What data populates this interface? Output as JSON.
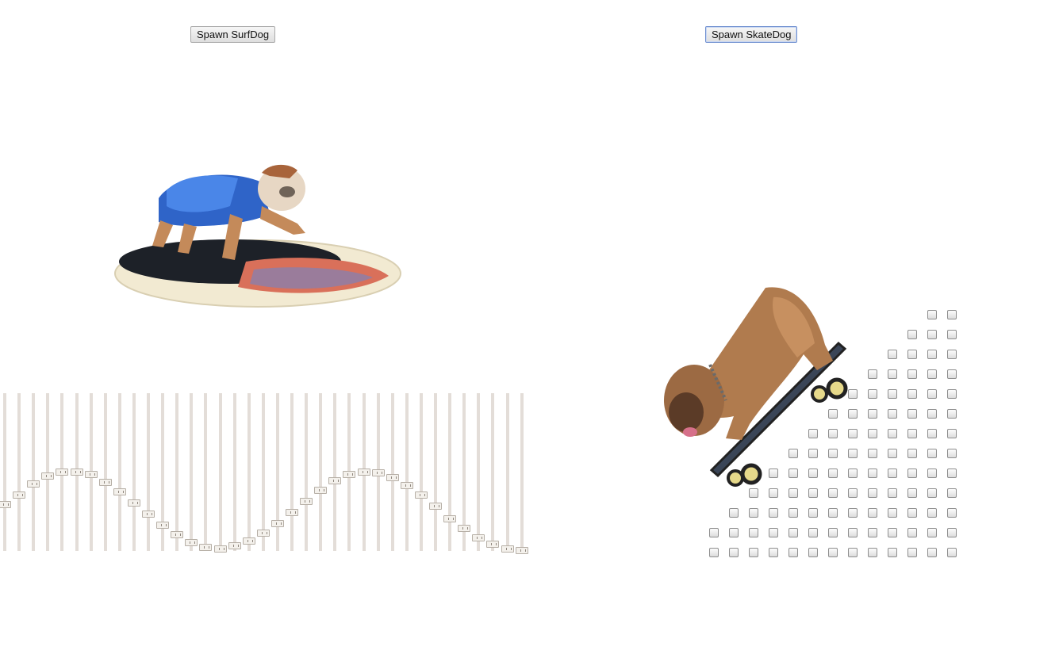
{
  "buttons": {
    "surf_label": "Spawn SurfDog",
    "skate_label": "Spawn SkateDog"
  },
  "surf_slider_rail": {
    "slider_count": 37,
    "slider_levels": [
      0.29,
      0.35,
      0.42,
      0.47,
      0.5,
      0.5,
      0.48,
      0.43,
      0.37,
      0.3,
      0.23,
      0.16,
      0.1,
      0.05,
      0.02,
      0.01,
      0.03,
      0.06,
      0.11,
      0.17,
      0.24,
      0.31,
      0.38,
      0.44,
      0.48,
      0.5,
      0.49,
      0.46,
      0.41,
      0.35,
      0.28,
      0.2,
      0.14,
      0.08,
      0.04,
      0.01,
      0.0
    ]
  },
  "skate_checkbox_stairs": {
    "columns": 13,
    "rows": 13,
    "column_heights": [
      2,
      3,
      4,
      5,
      6,
      7,
      8,
      9,
      10,
      11,
      12,
      13,
      13
    ]
  },
  "images": {
    "surf_dog": "bulldog-on-surfboard",
    "skate_dog": "bulldog-on-skateboard"
  }
}
